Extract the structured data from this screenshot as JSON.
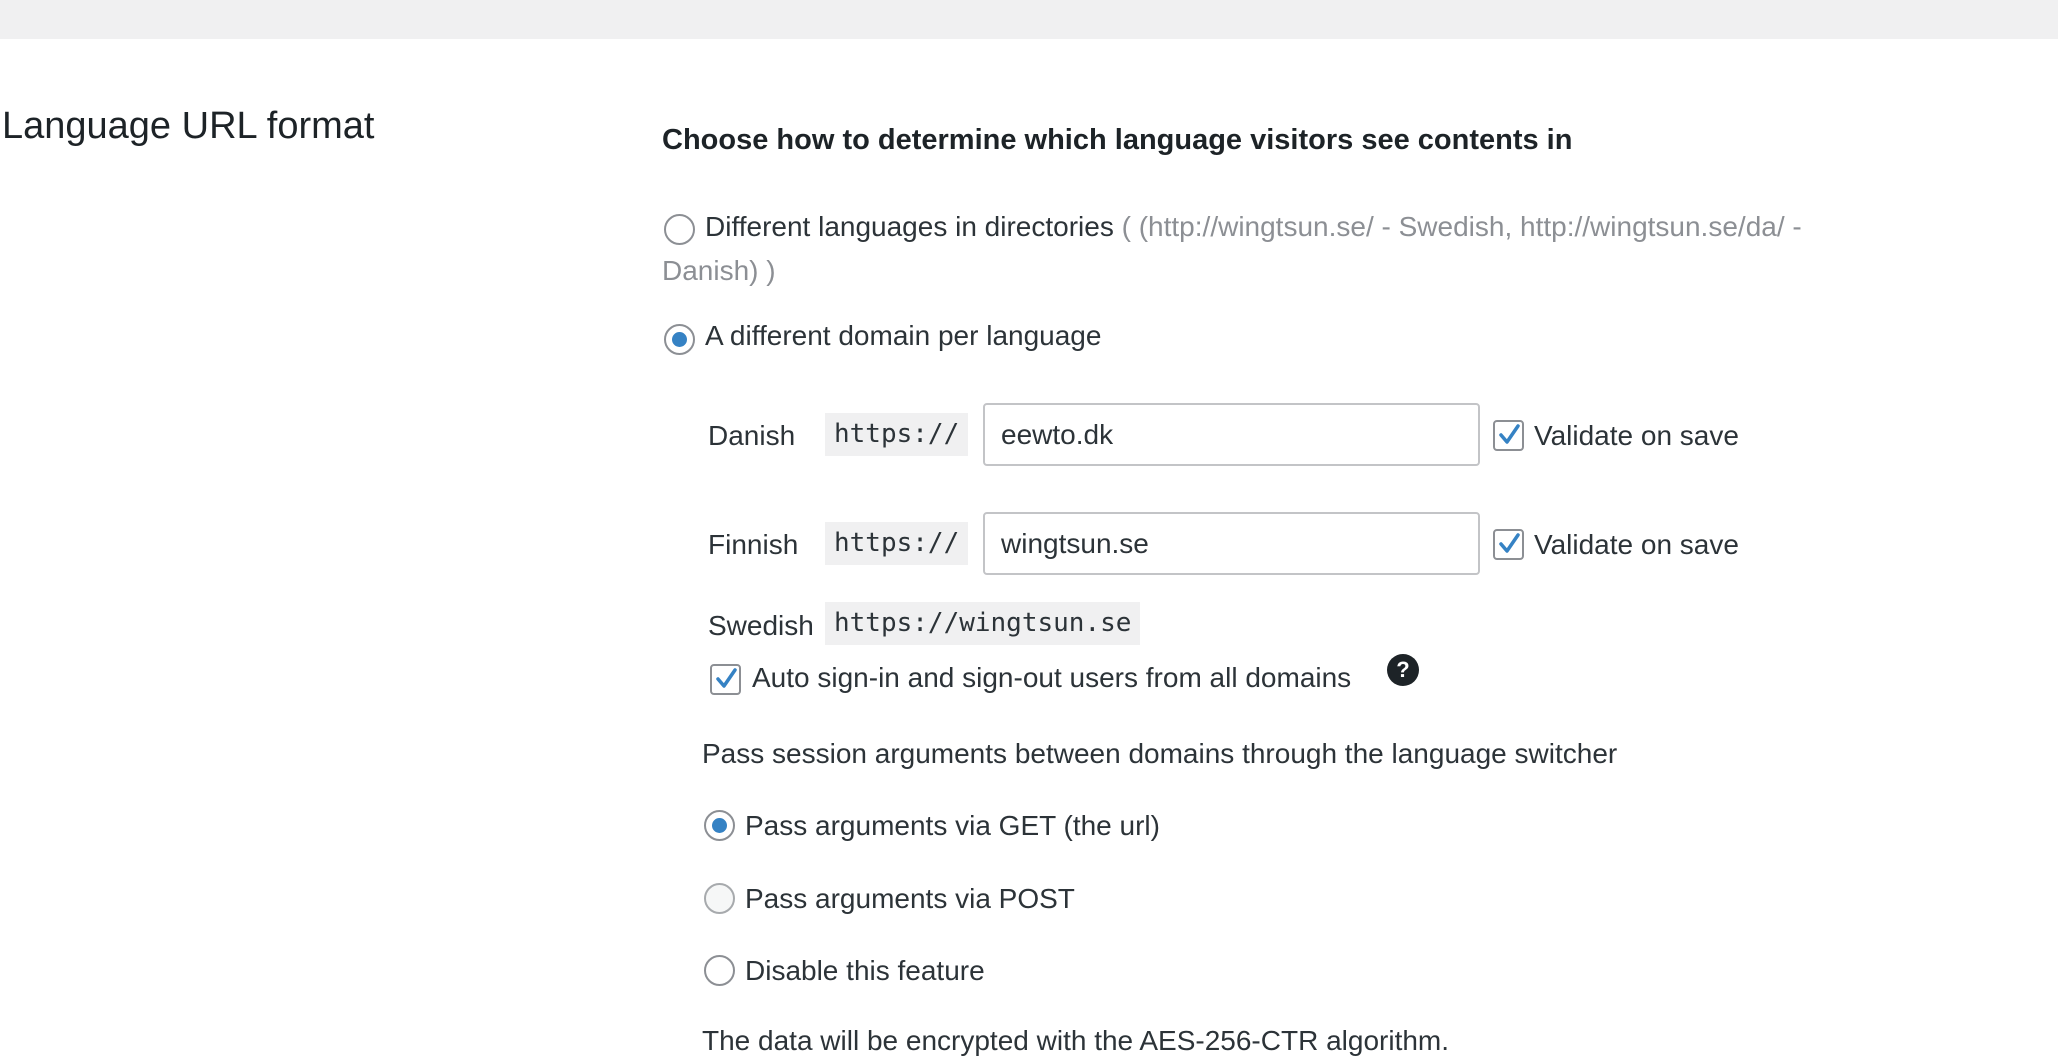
{
  "section_title": "Language URL format",
  "heading": "Choose how to determine which language visitors see contents in",
  "url_format_options": {
    "directories": {
      "label": "Different languages in directories",
      "hint_line1": "( (http://wingtsun.se/ - Swedish, http://wingtsun.se/da/ -",
      "hint_line2": "Danish) )",
      "checked": false
    },
    "domain_per_language": {
      "label": "A different domain per language",
      "checked": true
    }
  },
  "domains": {
    "danish": {
      "language": "Danish",
      "protocol": "https://",
      "value": "eewto.dk",
      "validate_label": "Validate on save",
      "validate_checked": true
    },
    "finnish": {
      "language": "Finnish",
      "protocol": "https://",
      "value": "wingtsun.se",
      "validate_label": "Validate on save",
      "validate_checked": true
    },
    "swedish": {
      "language": "Swedish",
      "url": "https://wingtsun.se"
    }
  },
  "auto_signin": {
    "label": "Auto sign-in and sign-out users from all domains",
    "checked": true,
    "help_glyph": "?"
  },
  "session_args": {
    "title": "Pass session arguments between domains through the language switcher",
    "options": {
      "get": {
        "label": "Pass arguments via GET (the url)",
        "checked": true
      },
      "post": {
        "label": "Pass arguments via POST",
        "checked": false
      },
      "disable": {
        "label": "Disable this feature",
        "checked": false
      }
    },
    "note": "The data will be encrypted with the AES-256-CTR algorithm."
  },
  "colors": {
    "accent": "#3582c4",
    "topbar": "#f0f0f1",
    "muted": "#8c8f94"
  }
}
